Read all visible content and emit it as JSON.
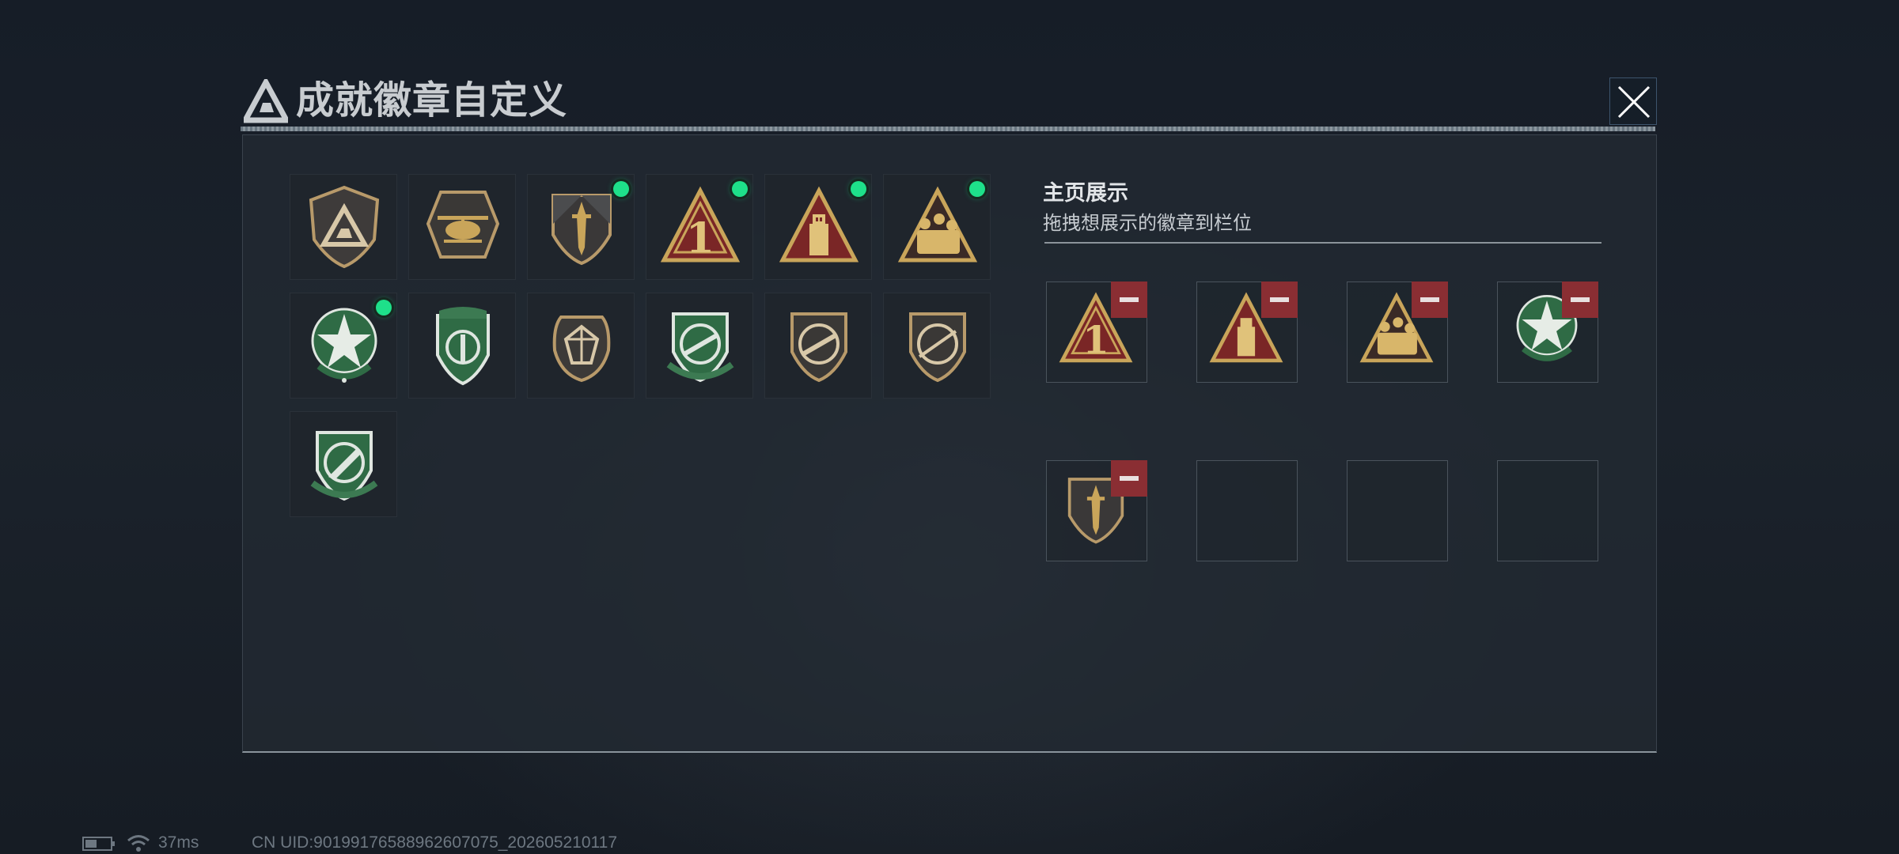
{
  "window": {
    "title": "成就徽章自定义"
  },
  "showcase": {
    "title": "主页展示",
    "subtitle": "拖拽想展示的徽章到栏位"
  },
  "badges": [
    {
      "icon": "triangle-logo-badge-icon",
      "new": false
    },
    {
      "icon": "helicopter-badge-icon",
      "new": false
    },
    {
      "icon": "dagger-shield-badge-icon",
      "new": true
    },
    {
      "icon": "rank-one-badge-icon",
      "new": true
    },
    {
      "icon": "usb-badge-icon",
      "new": true
    },
    {
      "icon": "squad-badge-icon",
      "new": true
    },
    {
      "icon": "star-wreath-badge-icon",
      "new": true
    },
    {
      "icon": "green-shield-badge-icon",
      "new": false
    },
    {
      "icon": "crystal-badge-icon",
      "new": false
    },
    {
      "icon": "rifle-green-badge-icon",
      "new": false
    },
    {
      "icon": "rifle-bronze-badge-icon",
      "new": false
    },
    {
      "icon": "sniper-bronze-badge-icon",
      "new": false
    },
    {
      "icon": "knife-green-badge-icon",
      "new": false
    }
  ],
  "slots": [
    {
      "icon": "rank-one-badge-icon",
      "filled": true
    },
    {
      "icon": "usb-badge-icon",
      "filled": true
    },
    {
      "icon": "squad-badge-icon",
      "filled": true
    },
    {
      "icon": "star-wreath-badge-icon",
      "filled": true
    },
    {
      "icon": "dagger-shield-badge-icon",
      "filled": true
    },
    {
      "icon": "",
      "filled": false
    },
    {
      "icon": "",
      "filled": false
    },
    {
      "icon": "",
      "filled": false
    }
  ],
  "status": {
    "ping": "37ms",
    "uid": "CN UID:90199176588962607075_202605210117"
  },
  "colors": {
    "new_dot": "#1ee08a",
    "remove": "#8a2e33",
    "gold": "#c9a55a",
    "green": "#2f6b45"
  }
}
